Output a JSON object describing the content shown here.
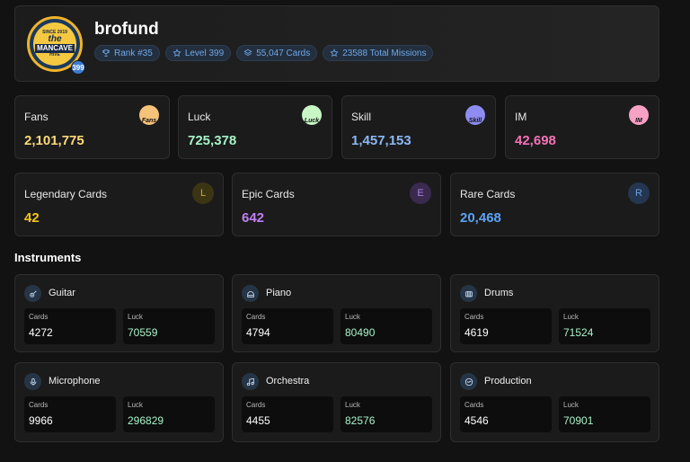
{
  "profile": {
    "username": "brofund",
    "avatar": {
      "top_text": "SINCE 2019",
      "the": "the",
      "main": "MANCAVE",
      "bottom_text": "HIVE"
    },
    "level_badge": "399",
    "tags": {
      "rank": "Rank #35",
      "level": "Level 399",
      "cards": "55,047 Cards",
      "missions": "23588 Total Missions"
    }
  },
  "stats": [
    {
      "label": "Fans",
      "value": "2,101,775",
      "icon": "fans-icon",
      "icon_text": "Fans",
      "color": "#fcd97a",
      "icon_bg": "#f5c27a"
    },
    {
      "label": "Luck",
      "value": "725,378",
      "icon": "luck-icon",
      "icon_text": "Luck",
      "color": "#a7f3c8",
      "icon_bg": "#c8f7c5"
    },
    {
      "label": "Skill",
      "value": "1,457,153",
      "icon": "skill-icon",
      "icon_text": "Skill",
      "color": "#8cb8f5",
      "icon_bg": "#8e8cf0"
    },
    {
      "label": "IM",
      "value": "42,698",
      "icon": "im-icon",
      "icon_text": "IM",
      "color": "#f472b6",
      "icon_bg": "#f7a1c4"
    }
  ],
  "rarity": [
    {
      "label": "Legendary Cards",
      "value": "42",
      "letter": "L",
      "color": "#f5c518",
      "icon_bg": "#3b3514",
      "icon_color": "#d4a72c"
    },
    {
      "label": "Epic Cards",
      "value": "642",
      "letter": "E",
      "color": "#c17ef5",
      "icon_bg": "#3a2a4e",
      "icon_color": "#b07ee0"
    },
    {
      "label": "Rare Cards",
      "value": "20,468",
      "letter": "R",
      "color": "#5ba3f5",
      "icon_bg": "#243650",
      "icon_color": "#6aa0e0"
    }
  ],
  "section_title": "Instruments",
  "cards_label": "Cards",
  "luck_label": "Luck",
  "instruments": [
    {
      "name": "Guitar",
      "icon": "guitar-icon",
      "cards": "4272",
      "luck": "70559"
    },
    {
      "name": "Piano",
      "icon": "piano-icon",
      "cards": "4794",
      "luck": "80490"
    },
    {
      "name": "Drums",
      "icon": "drums-icon",
      "cards": "4619",
      "luck": "71524"
    },
    {
      "name": "Microphone",
      "icon": "microphone-icon",
      "cards": "9966",
      "luck": "296829"
    },
    {
      "name": "Orchestra",
      "icon": "music-note-icon",
      "cards": "4455",
      "luck": "82576"
    },
    {
      "name": "Production",
      "icon": "production-icon",
      "cards": "4546",
      "luck": "70901"
    }
  ],
  "colors": {
    "accent": "#6fa8e8",
    "luck_value": "#a7f3c8"
  }
}
